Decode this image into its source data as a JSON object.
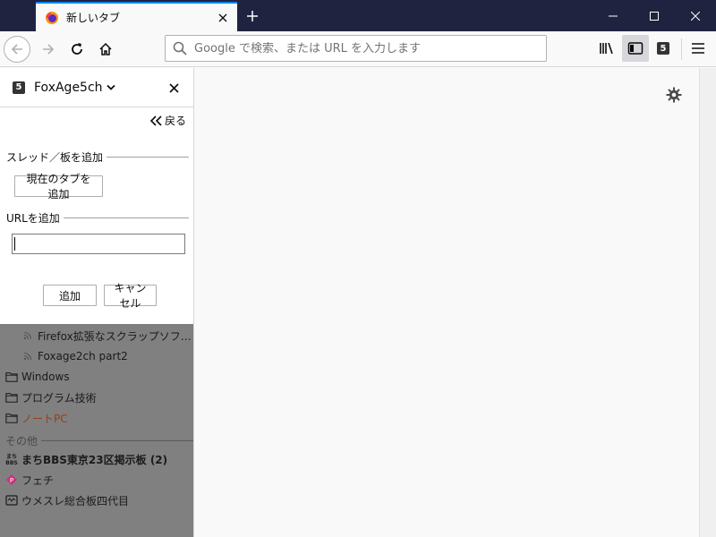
{
  "window": {
    "tab_title": "新しいタブ",
    "new_tab_symbol": "+"
  },
  "navbar": {
    "url_placeholder": "Google で検索、または URL を入力します"
  },
  "sidebar": {
    "badge": "5",
    "title": "FoxAge5ch",
    "back_label": "戻る",
    "add_thread_section": "スレッド／板を追加",
    "add_current_tab_button": "現在のタブを追加",
    "add_url_section": "URLを追加",
    "url_value": "",
    "add_button": "追加",
    "cancel_button": "キャンセル",
    "list": {
      "items": [
        {
          "label": "Firefox拡張なスクラップソフトScra...",
          "type": "rss"
        },
        {
          "label": "Foxage2ch part2",
          "type": "rss"
        },
        {
          "label": "Windows",
          "type": "folder"
        },
        {
          "label": "プログラム技術",
          "type": "folder"
        },
        {
          "label": "ノートPC",
          "type": "folder-highlight"
        }
      ],
      "group_label": "その他",
      "other_items": [
        {
          "label": "まちBBS東京23区掲示板 (2)",
          "type": "bbs"
        },
        {
          "label": "フェチ",
          "type": "pink"
        },
        {
          "label": "ウメスレ総合板四代目",
          "type": "board"
        }
      ]
    }
  },
  "colors": {
    "titlebar": "#202340",
    "accent": "#0a84ff",
    "folder_highlight_text": "#9a3d1c",
    "overlay": "#808080"
  }
}
